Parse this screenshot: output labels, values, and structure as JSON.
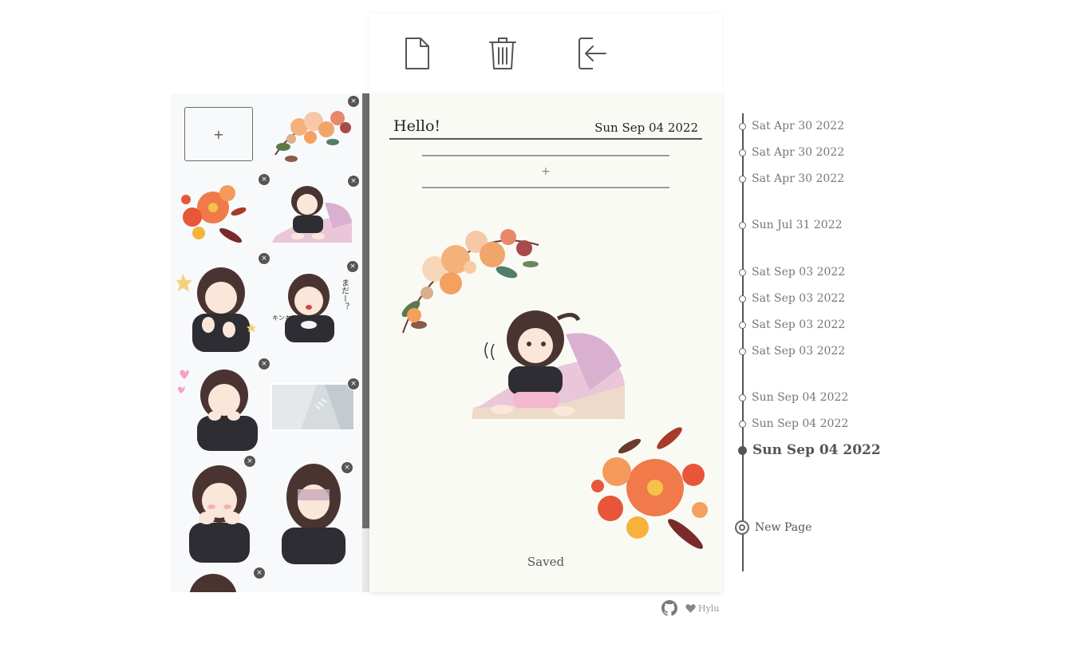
{
  "toolbar": {
    "new_icon": "file-icon",
    "delete_icon": "trash-icon",
    "logout_icon": "sign-in-icon"
  },
  "sidebar": {
    "add_label": "+",
    "close_glyph": "×",
    "stickers": [
      {
        "name": "autumn-roses-bouquet"
      },
      {
        "name": "red-flower-bouquet"
      },
      {
        "name": "girl-under-blanket"
      },
      {
        "name": "girl-thumbs-up-wink"
      },
      {
        "name": "girl-eating-rice-surprised"
      },
      {
        "name": "girl-smiling-hearts"
      },
      {
        "name": "street-photo"
      },
      {
        "name": "girl-blushing-hands-cheeks"
      },
      {
        "name": "girl-shadowed-face"
      },
      {
        "name": "girl-partial"
      }
    ],
    "sticker_texts": {
      "mada": "まだー？",
      "kin": "キンキン"
    }
  },
  "paper": {
    "title": "Hello!",
    "date": "Sun Sep 04 2022",
    "add_block_label": "+",
    "status": "Saved"
  },
  "timeline": {
    "entries": [
      {
        "label": "Sat Apr 30 2022"
      },
      {
        "label": "Sat Apr 30 2022"
      },
      {
        "label": "Sat Apr 30 2022"
      },
      {
        "label": "Sun Jul 31 2022"
      },
      {
        "label": "Sat Sep 03 2022"
      },
      {
        "label": "Sat Sep 03 2022"
      },
      {
        "label": "Sat Sep 03 2022"
      },
      {
        "label": "Sat Sep 03 2022"
      },
      {
        "label": "Sun Sep 04 2022"
      },
      {
        "label": "Sun Sep 04 2022"
      },
      {
        "label": "Sun Sep 04 2022",
        "active": true
      }
    ],
    "new_page_label": "New Page"
  },
  "footer": {
    "github_icon": "github-icon",
    "heart_icon": "heart-icon",
    "author": "Hylu"
  },
  "colors": {
    "paper_bg": "#fafaf5",
    "sidebar_bg": "#f8f9fa",
    "timeline_line": "#555555",
    "accent_orange": "#f07a4a",
    "hair_brown": "#4a3431",
    "hoodie_black": "#2d2d33"
  }
}
